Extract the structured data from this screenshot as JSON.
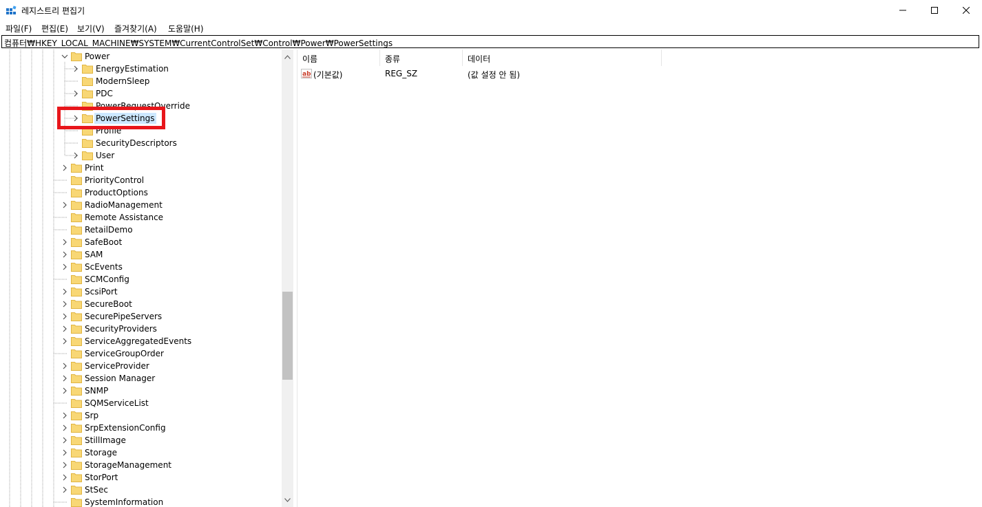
{
  "window": {
    "title": "레지스트리 편집기",
    "minimize_glyph": "—",
    "maximize_glyph": "☐",
    "close_glyph": "✕"
  },
  "menu": [
    {
      "label": "파일(F)"
    },
    {
      "label": "편집(E)"
    },
    {
      "label": "보기(V)"
    },
    {
      "label": "즐겨찾기(A)"
    },
    {
      "label": "도움말(H)"
    }
  ],
  "address": "컴퓨터₩HKEY_LOCAL_MACHINE₩SYSTEM₩CurrentControlSet₩Control₩Power₩PowerSettings",
  "tree": {
    "items": [
      {
        "label": "Power",
        "level": 1,
        "expand": "open"
      },
      {
        "label": "EnergyEstimation",
        "level": 2,
        "expand": "closed"
      },
      {
        "label": "ModernSleep",
        "level": 2,
        "expand": "none"
      },
      {
        "label": "PDC",
        "level": 2,
        "expand": "closed"
      },
      {
        "label": "PowerRequestOverride",
        "level": 2,
        "expand": "none"
      },
      {
        "label": "PowerSettings",
        "level": 2,
        "expand": "closed",
        "selected": true
      },
      {
        "label": "Profile",
        "level": 2,
        "expand": "none"
      },
      {
        "label": "SecurityDescriptors",
        "level": 2,
        "expand": "none"
      },
      {
        "label": "User",
        "level": 2,
        "expand": "closed"
      },
      {
        "label": "Print",
        "level": 1,
        "expand": "closed"
      },
      {
        "label": "PriorityControl",
        "level": 1,
        "expand": "none"
      },
      {
        "label": "ProductOptions",
        "level": 1,
        "expand": "none"
      },
      {
        "label": "RadioManagement",
        "level": 1,
        "expand": "closed"
      },
      {
        "label": "Remote Assistance",
        "level": 1,
        "expand": "none"
      },
      {
        "label": "RetailDemo",
        "level": 1,
        "expand": "none"
      },
      {
        "label": "SafeBoot",
        "level": 1,
        "expand": "closed"
      },
      {
        "label": "SAM",
        "level": 1,
        "expand": "closed"
      },
      {
        "label": "ScEvents",
        "level": 1,
        "expand": "closed"
      },
      {
        "label": "SCMConfig",
        "level": 1,
        "expand": "none"
      },
      {
        "label": "ScsiPort",
        "level": 1,
        "expand": "closed"
      },
      {
        "label": "SecureBoot",
        "level": 1,
        "expand": "closed"
      },
      {
        "label": "SecurePipeServers",
        "level": 1,
        "expand": "closed"
      },
      {
        "label": "SecurityProviders",
        "level": 1,
        "expand": "closed"
      },
      {
        "label": "ServiceAggregatedEvents",
        "level": 1,
        "expand": "closed"
      },
      {
        "label": "ServiceGroupOrder",
        "level": 1,
        "expand": "none"
      },
      {
        "label": "ServiceProvider",
        "level": 1,
        "expand": "closed"
      },
      {
        "label": "Session Manager",
        "level": 1,
        "expand": "closed"
      },
      {
        "label": "SNMP",
        "level": 1,
        "expand": "closed"
      },
      {
        "label": "SQMServiceList",
        "level": 1,
        "expand": "none"
      },
      {
        "label": "Srp",
        "level": 1,
        "expand": "closed"
      },
      {
        "label": "SrpExtensionConfig",
        "level": 1,
        "expand": "closed"
      },
      {
        "label": "StillImage",
        "level": 1,
        "expand": "closed"
      },
      {
        "label": "Storage",
        "level": 1,
        "expand": "closed"
      },
      {
        "label": "StorageManagement",
        "level": 1,
        "expand": "closed"
      },
      {
        "label": "StorPort",
        "level": 1,
        "expand": "closed"
      },
      {
        "label": "StSec",
        "level": 1,
        "expand": "closed"
      },
      {
        "label": "SystemInformation",
        "level": 1,
        "expand": "none"
      }
    ]
  },
  "list": {
    "columns": [
      {
        "label": "이름"
      },
      {
        "label": "종류"
      },
      {
        "label": "데이터"
      }
    ],
    "rows": [
      {
        "name": "(기본값)",
        "type": "REG_SZ",
        "data": "(값 설정 안 됨)"
      }
    ]
  },
  "colors": {
    "highlight_box": "#e8161b",
    "selection": "#cce8ff",
    "folder": "#f8d775",
    "folder_dark": "#e0b440"
  },
  "icons": {
    "app": "registry-editor-icon",
    "folder": "folder-icon",
    "value": "string-value-icon"
  }
}
